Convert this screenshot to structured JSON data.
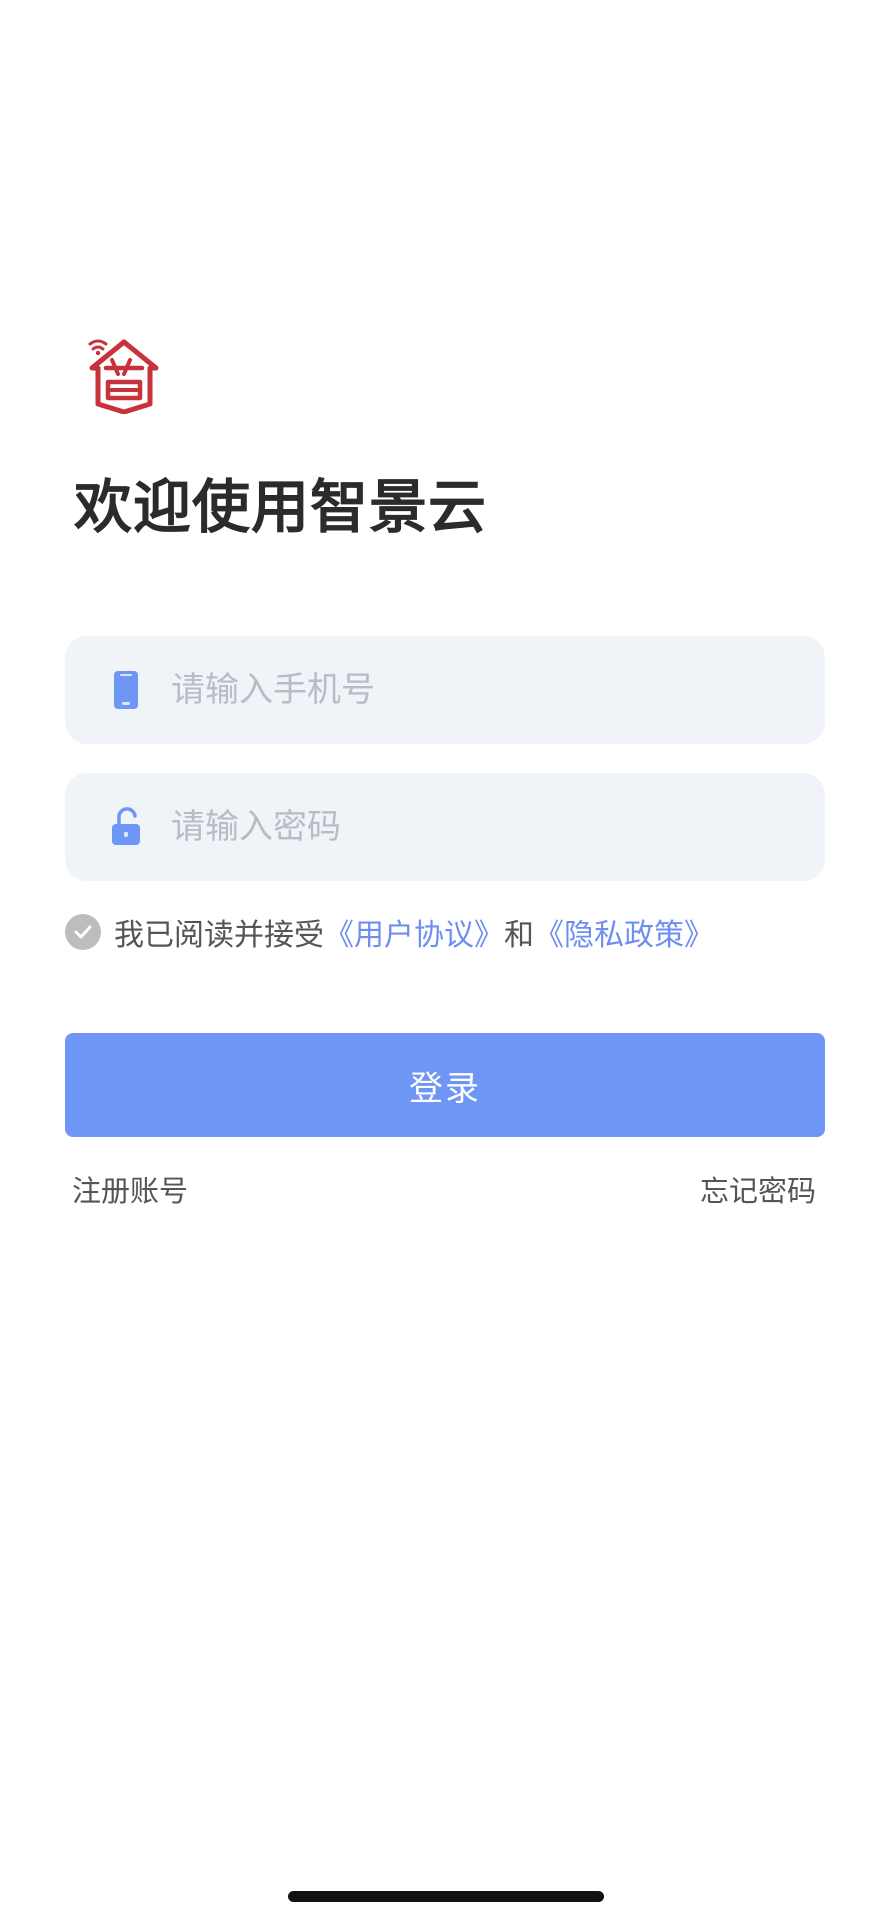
{
  "app": {
    "title": "欢迎使用智景云",
    "logo_icon": "zhijing-house-wifi-logo",
    "brand_color": "#c8323a"
  },
  "form": {
    "phone": {
      "placeholder": "请输入手机号",
      "value": "",
      "icon": "phone-icon"
    },
    "password": {
      "placeholder": "请输入密码",
      "value": "",
      "icon": "unlock-icon"
    },
    "agreement": {
      "checked": true,
      "prefix": "我已阅读并接受",
      "user_agreement": "《用户协议》",
      "connector": "和",
      "privacy_policy": "《隐私政策》"
    },
    "login_label": "登录",
    "register_label": "注册账号",
    "forgot_label": "忘记密码"
  },
  "colors": {
    "accent": "#6e97f5",
    "link": "#6f8ff0",
    "field_bg": "#f0f3f7",
    "check_bg": "#bdbdbd"
  }
}
